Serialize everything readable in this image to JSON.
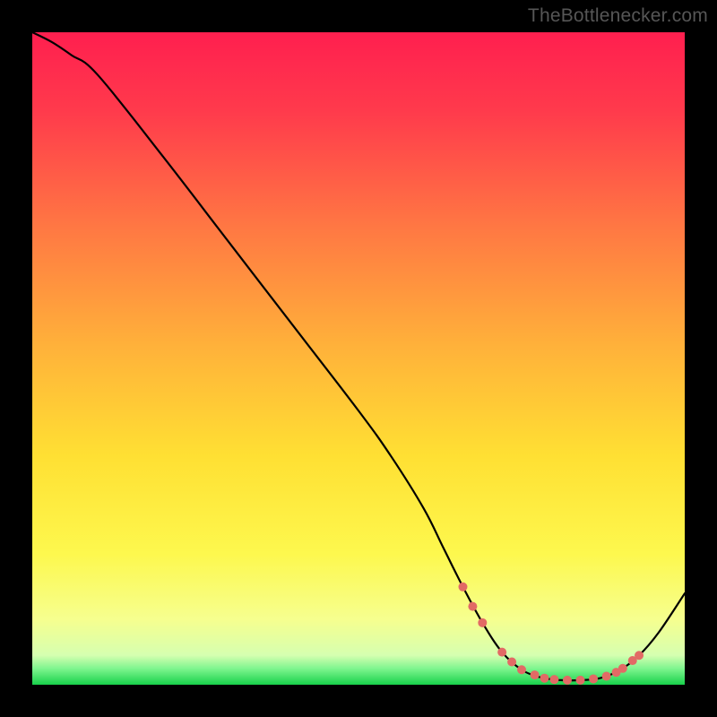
{
  "watermark": {
    "text": "TheBottlenecker.com"
  },
  "chart_data": {
    "type": "line",
    "title": "",
    "xlabel": "",
    "ylabel": "",
    "xlim": [
      0,
      100
    ],
    "ylim": [
      0,
      100
    ],
    "grid": false,
    "series": [
      {
        "name": "curve",
        "x": [
          0,
          3,
          6,
          10,
          20,
          30,
          40,
          50,
          55,
          60,
          63,
          66,
          69,
          72,
          75,
          78,
          81,
          84,
          87,
          90,
          93,
          96,
          100
        ],
        "y": [
          100,
          98.5,
          96.5,
          93.5,
          81,
          68,
          55,
          42,
          35,
          27,
          21,
          15,
          9.5,
          5,
          2.3,
          1.1,
          0.7,
          0.7,
          1.0,
          2.2,
          4.5,
          8,
          14
        ]
      }
    ],
    "markers": {
      "name": "highlight-dots",
      "color": "#e26a65",
      "points": [
        {
          "x": 66,
          "y": 15
        },
        {
          "x": 67.5,
          "y": 12
        },
        {
          "x": 69,
          "y": 9.5
        },
        {
          "x": 72,
          "y": 5
        },
        {
          "x": 73.5,
          "y": 3.5
        },
        {
          "x": 75,
          "y": 2.3
        },
        {
          "x": 77,
          "y": 1.5
        },
        {
          "x": 78.5,
          "y": 1.0
        },
        {
          "x": 80,
          "y": 0.8
        },
        {
          "x": 82,
          "y": 0.7
        },
        {
          "x": 84,
          "y": 0.7
        },
        {
          "x": 86,
          "y": 0.9
        },
        {
          "x": 88,
          "y": 1.3
        },
        {
          "x": 89.5,
          "y": 1.9
        },
        {
          "x": 90.5,
          "y": 2.5
        },
        {
          "x": 92,
          "y": 3.7
        },
        {
          "x": 93,
          "y": 4.5
        }
      ]
    },
    "background_gradient": {
      "stops": [
        {
          "offset": 0.0,
          "color": "#ff1f4f"
        },
        {
          "offset": 0.12,
          "color": "#ff3a4c"
        },
        {
          "offset": 0.3,
          "color": "#ff7843"
        },
        {
          "offset": 0.48,
          "color": "#ffb13a"
        },
        {
          "offset": 0.65,
          "color": "#ffe033"
        },
        {
          "offset": 0.8,
          "color": "#fdf84e"
        },
        {
          "offset": 0.9,
          "color": "#f6ff8f"
        },
        {
          "offset": 0.955,
          "color": "#d6ffb0"
        },
        {
          "offset": 0.975,
          "color": "#7ff58f"
        },
        {
          "offset": 1.0,
          "color": "#18d14b"
        }
      ]
    }
  }
}
